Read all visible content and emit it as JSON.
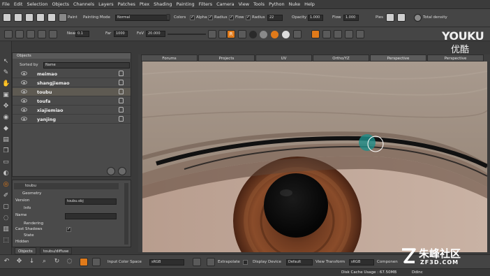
{
  "menu": [
    "File",
    "Edit",
    "Selection",
    "Objects",
    "Channels",
    "Layers",
    "Patches",
    "Ptex",
    "Shading",
    "Painting",
    "Filters",
    "Camera",
    "View",
    "Tools",
    "Python",
    "Nuke",
    "Help"
  ],
  "toolbar1": {
    "paint_label": "Paint",
    "painting_mode_label": "Painting Mode",
    "painting_mode_value": "Normal",
    "colors_label": "Colors",
    "alpha_label": "Alpha",
    "radius_label": "Radius",
    "flow_label": "Flow",
    "radius2_label": "Radius",
    "radius_value": "22",
    "opacity_label": "Opacity",
    "opacity_value": "1.000",
    "flow2_label": "Flow",
    "flow_value": "1.000",
    "pies_label": "Pies",
    "total_density_label": "Total density"
  },
  "toolbar2": {
    "near_label": "Near",
    "near_value": "0.1",
    "far_label": "Far",
    "far_value": "1000",
    "fov_label": "FoV",
    "fov_value": "20.000",
    "lod_label": "R"
  },
  "objects_panel": {
    "title": "Objects",
    "sorted_by_label": "Sorted by",
    "sorted_by_value": "Name",
    "items": [
      {
        "name": "meimao",
        "selected": false
      },
      {
        "name": "shangjiemao",
        "selected": false
      },
      {
        "name": "toubu",
        "selected": true
      },
      {
        "name": "toufa",
        "selected": false
      },
      {
        "name": "xiajiemiao",
        "selected": false
      },
      {
        "name": "yanjing",
        "selected": false
      }
    ]
  },
  "props_panel": {
    "object_name": "toubu",
    "geometry_label": "Geometry",
    "version_label": "Version",
    "version_value": "toubu.obj",
    "info_label": "Info",
    "name_label": "Name",
    "rendering_label": "Rendering",
    "cast_shadows_label": "Cast Shadows",
    "state_label": "State",
    "hidden_label": "Hidden"
  },
  "bottom_tabs": [
    "Objects",
    "toubu/diffuse"
  ],
  "viewport_tabs": [
    {
      "label": "Forums",
      "active": false
    },
    {
      "label": "Projects",
      "active": false
    },
    {
      "label": "UV",
      "active": false
    },
    {
      "label": "Ortho/YZ",
      "active": false
    },
    {
      "label": "Perspective",
      "active": true
    },
    {
      "label": "Perspective",
      "active": false
    }
  ],
  "bottom_bar": {
    "input_color_space_label": "Input Color Space",
    "input_color_space_value": "sRGB",
    "extrapolate_label": "Extrapolate",
    "display_device_label": "Display Device",
    "display_device_value": "Default",
    "view_transform_label": "View Transform",
    "view_transform_value": "sRGB",
    "component_label": "Componen"
  },
  "status": {
    "disk_cache": "Disk Cache Usage : 67.50MB",
    "extra": "Ddinc"
  },
  "watermarks": {
    "youku": "YOUKU",
    "youku_cn": "优酷",
    "zf3d_cn": "朱峰社区",
    "zf3d_url": "ZF3D.COM"
  },
  "colors": {
    "accent_orange": "#e07a1a",
    "brush_cursor": "#1f8f8a"
  }
}
